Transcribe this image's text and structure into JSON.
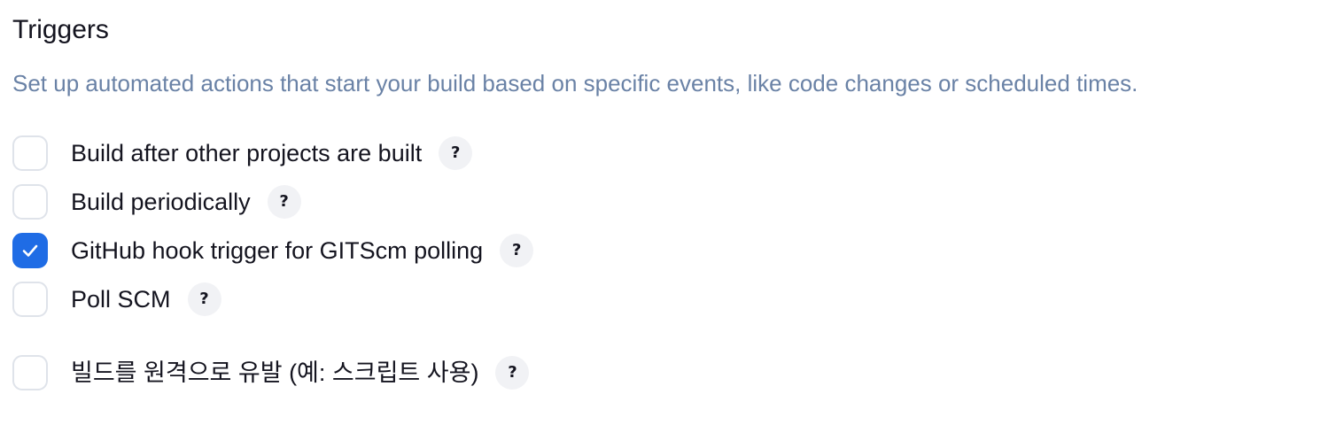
{
  "triggers": {
    "title": "Triggers",
    "description": "Set up automated actions that start your build based on specific events, like code changes or scheduled times.",
    "help_glyph": "?",
    "options": [
      {
        "label": "Build after other projects are built",
        "checked": false
      },
      {
        "label": "Build periodically",
        "checked": false
      },
      {
        "label": "GitHub hook trigger for GITScm polling",
        "checked": true
      },
      {
        "label": "Poll SCM",
        "checked": false
      },
      {
        "label": "빌드를 원격으로 유발 (예: 스크립트 사용)",
        "checked": false
      }
    ]
  },
  "colors": {
    "accent": "#1f6ce5",
    "description_text": "#6a82a6",
    "checkbox_border": "#dfe3ea",
    "help_bg": "#f1f2f5"
  },
  "icons": {
    "checked_mark": "checkmark-icon",
    "help": "help-icon"
  }
}
